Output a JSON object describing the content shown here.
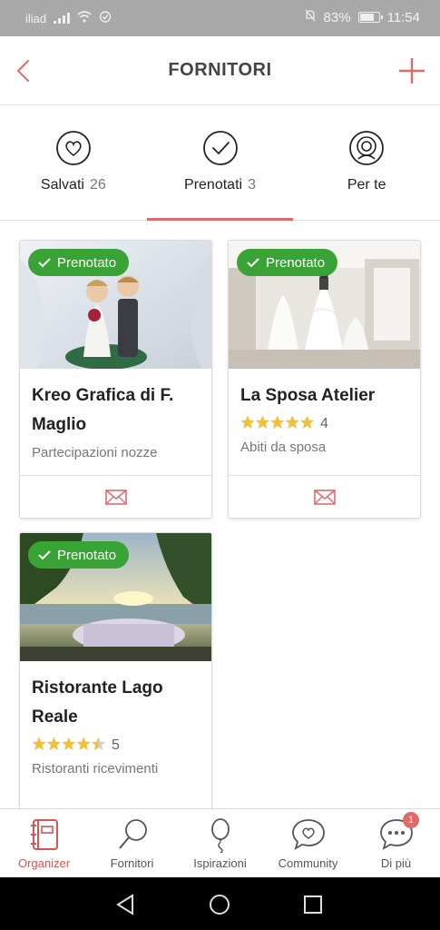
{
  "status_bar": {
    "carrier": "iliad",
    "battery": "83%",
    "battery_level": 0.83,
    "time": "11:54"
  },
  "header": {
    "title": "FORNITORI"
  },
  "tabs": [
    {
      "label": "Salvati",
      "count": "26",
      "icon": "heart-icon"
    },
    {
      "label": "Prenotati",
      "count": "3",
      "icon": "check-circle-icon"
    },
    {
      "label": "Per te",
      "count": "",
      "icon": "target-icon"
    }
  ],
  "active_tab": 1,
  "colors": {
    "accent": "#e06a6a",
    "badge": "#3aa335",
    "star": "#f0c23b"
  },
  "cards": [
    {
      "badge": "Prenotato",
      "name": "Kreo Grafica di F. Maglio",
      "rating": "",
      "category": "Partecipazioni nozze",
      "footer_icon": "mail-icon"
    },
    {
      "badge": "Prenotato",
      "name": "La Sposa Atelier",
      "rating": "4",
      "stars": 5,
      "category": "Abiti da sposa",
      "footer_icon": "mail-icon"
    },
    {
      "badge": "Prenotato",
      "name": "Ristorante Lago Reale",
      "rating": "5",
      "stars": 4.5,
      "category": "Ristoranti ricevimenti",
      "footer_icon": "mail-icon"
    }
  ],
  "bottom_nav": [
    {
      "label": "Organizer",
      "icon": "notebook-icon",
      "active": true
    },
    {
      "label": "Fornitori",
      "icon": "search-icon",
      "active": false
    },
    {
      "label": "Ispirazioni",
      "icon": "balloon-icon",
      "active": false
    },
    {
      "label": "Community",
      "icon": "chat-heart-icon",
      "active": false
    },
    {
      "label": "Di più",
      "icon": "more-icon",
      "active": false,
      "badge": "1"
    }
  ]
}
